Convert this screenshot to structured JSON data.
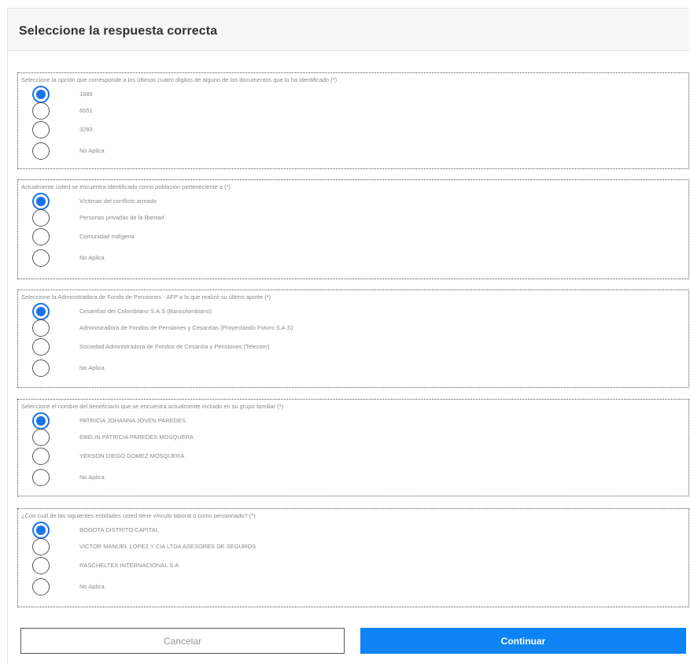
{
  "header": {
    "title": "Seleccione la respuesta correcta"
  },
  "questions": [
    {
      "text": "Seleccione la opción que corresponde a los últimos cuatro dígitos de alguno de los documentos que lo ha identificado (*)",
      "options": [
        "1886",
        "6551",
        "3283",
        "No Aplica"
      ],
      "selected": 0
    },
    {
      "text": "Actualmente usted se encuentra identificado como población perteneciente a (*)",
      "options": [
        "Víctimas del conflicto armado",
        "Personas privadas de la libertad",
        "Comunidad Indígena",
        "No Aplica"
      ],
      "selected": 0
    },
    {
      "text": "Seleccione la Administradora de Fondo de Pensiones - AFP a la que realizó su último aporte (*)",
      "options": [
        "Cesantías del Colombiano S.A.S (Bancolombiano)",
        "Administradora de Fondos de Pensiones y Cesantías (Proyectando Futuro S.A.S)",
        "Sociedad Administradora de Fondos de Cesantía y Pensiones (Telecom)",
        "No Aplica"
      ],
      "selected": 0
    },
    {
      "text": "Seleccione el nombre del beneficiario que se encuentra actualmente incluido en su grupo familiar (*)",
      "options": [
        "PATRICIA JOHANNA JOVEN PAREDES",
        "EBELIN PATRICIA PAREDES MOSQUERA",
        "YERSON DIEGO GOMEZ MOSQUERA",
        "No Aplica"
      ],
      "selected": 0
    },
    {
      "text": "¿Con cuál de las siguientes entidades usted tiene vínculo laboral o como pensionado? (*)",
      "options": [
        "BOGOTA DISTRITO CAPITAL",
        "VICTOR MANUEL LOPEZ Y CIA LTDA ASESORES DE SEGUROS",
        "RASCHELTEX INTERNACIONAL S.A",
        "No Aplica"
      ],
      "selected": 0
    }
  ],
  "buttons": {
    "cancel": "Cancelar",
    "continue": "Continuar"
  },
  "colors": {
    "accent": "#1a73e8",
    "primary_button": "#0d84f5"
  }
}
